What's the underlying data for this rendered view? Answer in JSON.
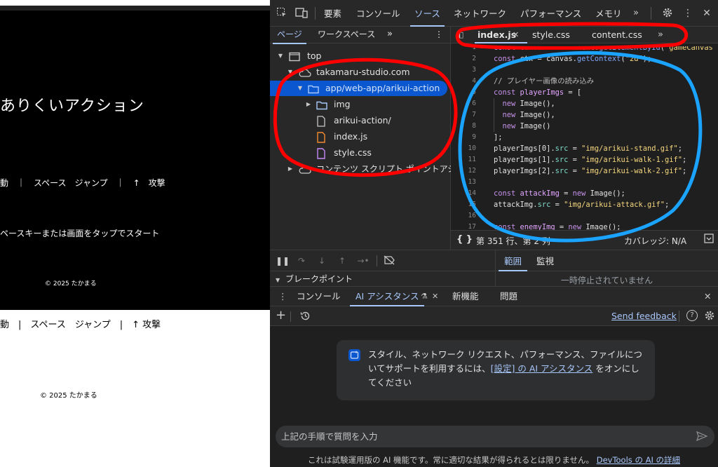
{
  "page": {
    "title": "ありくいアクション",
    "controls": "動　｜　スペース　ジャンプ　｜　↑　攻撃",
    "hint": "ペースキーまたは画面をタップでスタート",
    "copyright": "© 2025 たかまる",
    "below_controls": "動　|　スペース　ジャンプ　|　↑ 攻撃",
    "below_copyright": "© 2025 たかまる"
  },
  "devtools": {
    "main_tabs": [
      "要素",
      "コンソール",
      "ソース",
      "ネットワーク",
      "パフォーマンス",
      "メモリ"
    ],
    "active_tab": "ソース",
    "navigator": {
      "tabs": [
        "ページ",
        "ワークスペース"
      ],
      "tree": {
        "top": "top",
        "domain": "takamaru-studio.com",
        "folder": "app/web-app/arikui-action",
        "img": "img",
        "sub": "arikui-action/",
        "js": "index.js",
        "css": "style.css",
        "ext": "コンテンツ スクリプト ポイントアシ..."
      }
    },
    "editor": {
      "tabs": [
        "index.js",
        "style.css",
        "content.css"
      ],
      "status_position": "第 351 行、第 2 列",
      "status_coverage": "カバレッジ: N/A"
    },
    "debugger": {
      "breakpoints": "ブレークポイント",
      "scope_tabs": [
        "範囲",
        "監視"
      ],
      "not_paused": "一時停止されていません"
    },
    "drawer": {
      "tabs": [
        "コンソール",
        "AI アシスタンス",
        "新機能",
        "問題"
      ],
      "send_feedback": "Send feedback",
      "card_text_1": "スタイル、ネットワーク リクエスト、パフォーマンス、ファイルについてサポートを利用するには、",
      "card_link": "[設定] の AI アシスタンス",
      "card_text_2": " をオンにしてください",
      "prompt_placeholder": "上記の手順で質問を入力",
      "disclaimer": "これは試験運用版の AI 機能です。常に適切な結果が得られるとは限りません。",
      "disclaimer_link": "DevTools の AI の詳細"
    }
  },
  "colors": {
    "accent": "#a8c7fa",
    "annotation_red": "#ff0000",
    "annotation_blue": "#1aa3ff"
  }
}
